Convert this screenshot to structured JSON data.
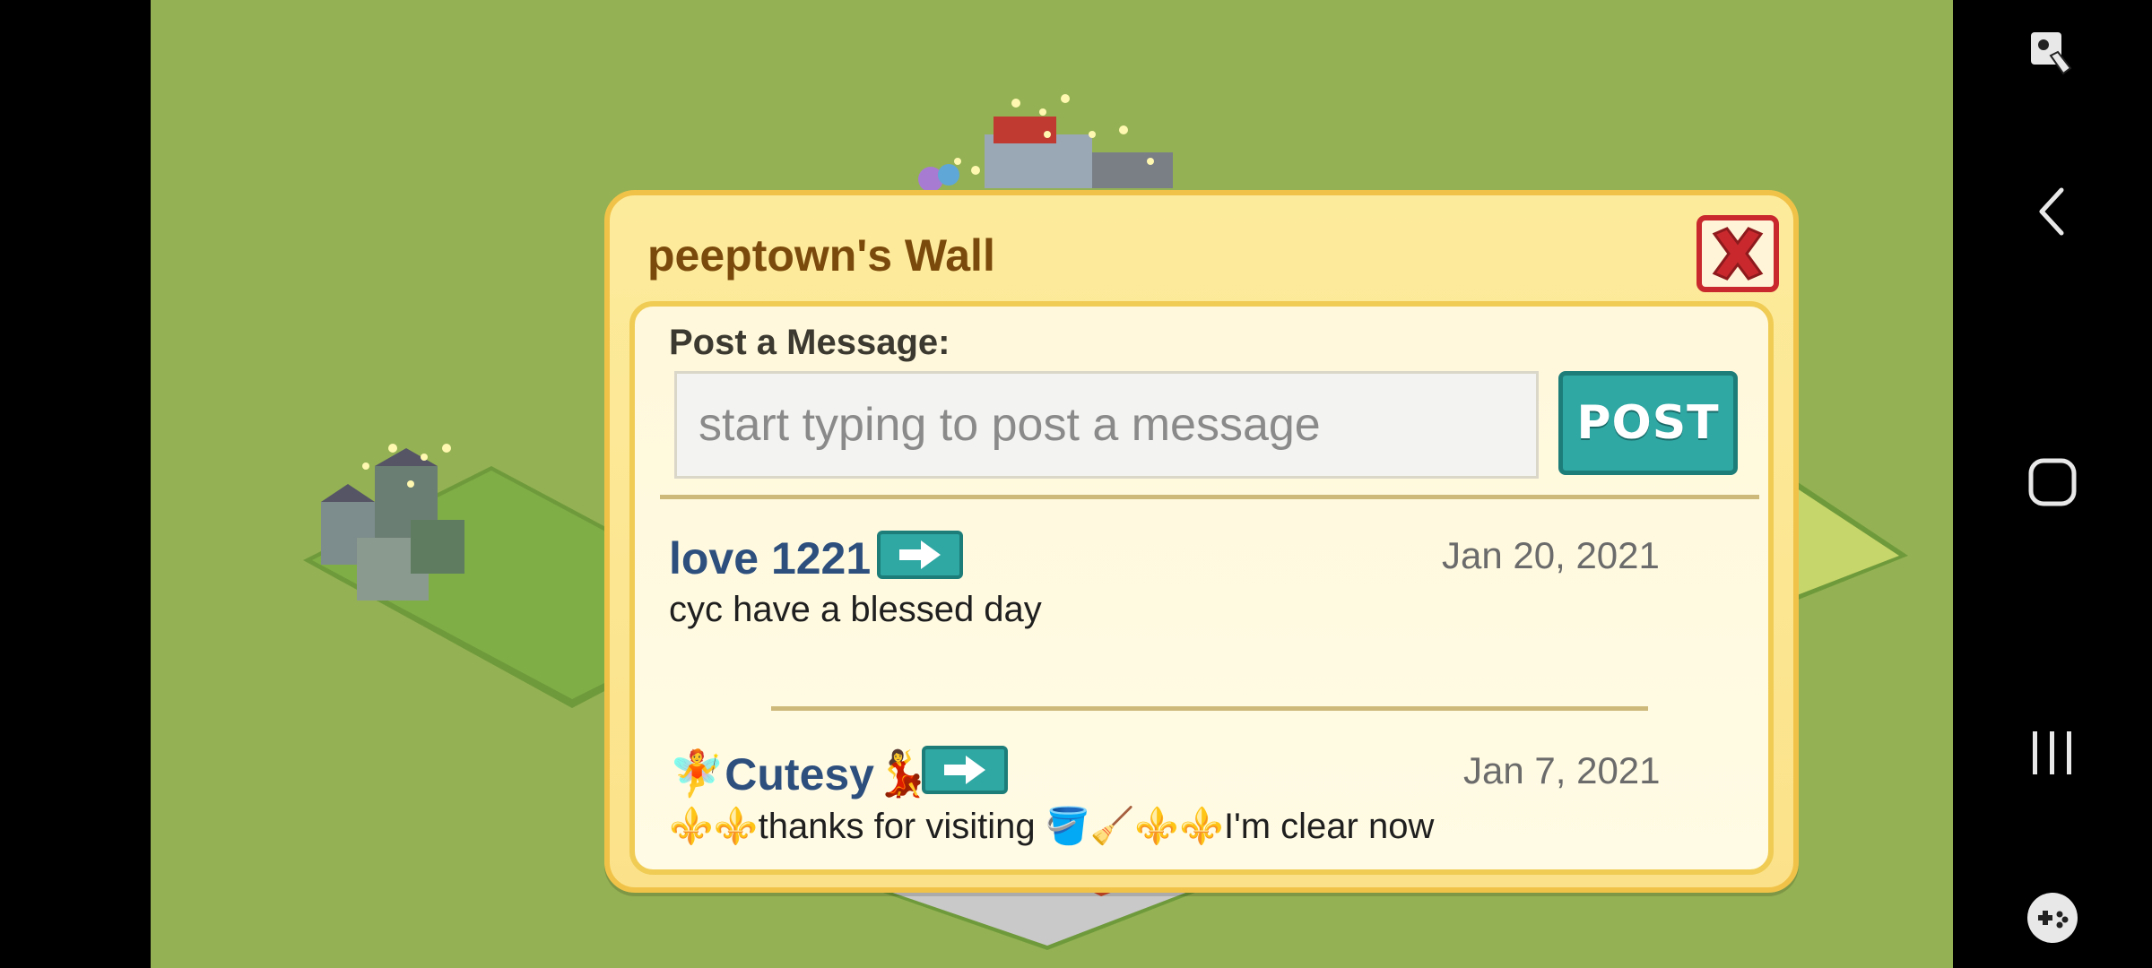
{
  "colors": {
    "game_bg": "#94b253",
    "modal_bg": "#fdeb9c",
    "title": "#7a4a0c",
    "accent": "#2fa7a3",
    "close": "#c9292d",
    "name": "#2d4f7e"
  },
  "dialog": {
    "title": "peeptown's Wall",
    "close_icon": "close-x-icon",
    "post_label": "Post a Message:",
    "input_placeholder": "start typing to post a message",
    "input_value": "",
    "post_button": "POST"
  },
  "messages": [
    {
      "name": "love 1221",
      "date": "Jan 20, 2021",
      "text": "cyc have a blessed day",
      "icon": "arrow-right-icon"
    },
    {
      "name_prefix": "🧚",
      "name": "Cutesy",
      "name_suffix": "💃",
      "date": "Jan 7, 2021",
      "text": "⚜️⚜️thanks for visiting 🪣🧹⚜️⚜️I'm clear now",
      "icon": "arrow-right-icon"
    }
  ],
  "system_nav": {
    "top_icon": "screen-touch-icon",
    "back_icon": "back-icon",
    "home_icon": "home-icon",
    "recents_icon": "recents-icon",
    "game_icon": "game-controller-icon"
  }
}
